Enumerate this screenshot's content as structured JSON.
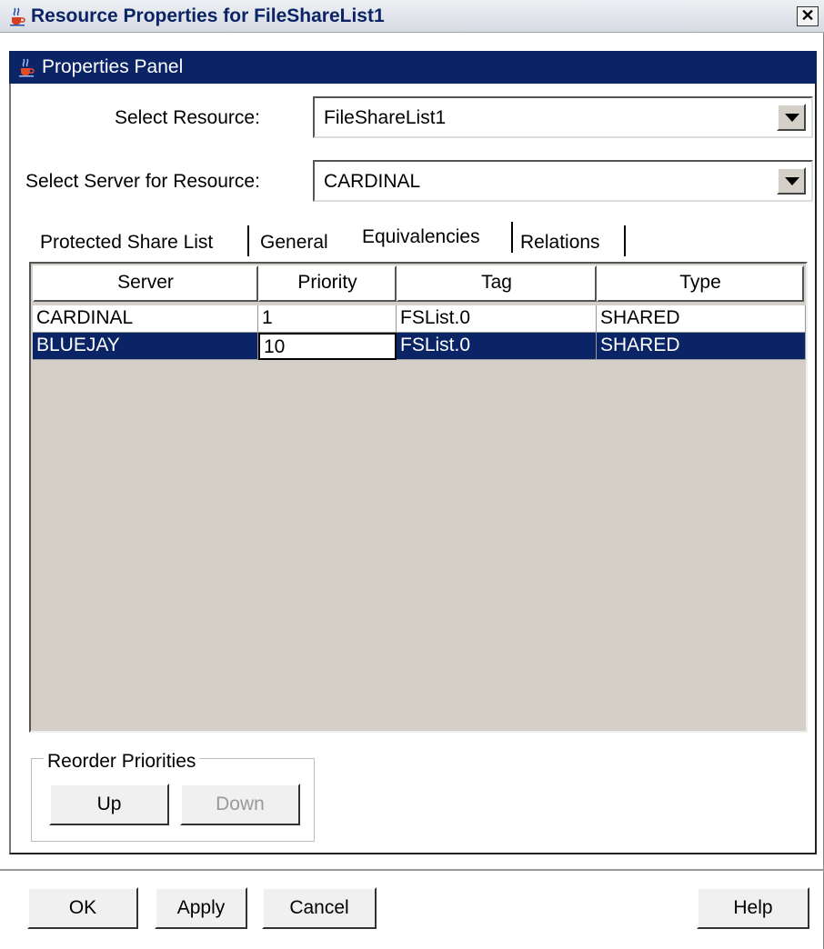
{
  "window": {
    "title": "Resource Properties for FileShareList1",
    "close_glyph": "✕"
  },
  "panel": {
    "title": "Properties Panel"
  },
  "select_resource": {
    "label": "Select Resource:",
    "value": "FileShareList1"
  },
  "select_server": {
    "label": "Select Server for Resource:",
    "value": "CARDINAL"
  },
  "tabs": [
    {
      "label": "Protected Share List"
    },
    {
      "label": "General"
    },
    {
      "label": "Equivalencies",
      "active": true
    },
    {
      "label": "Relations"
    }
  ],
  "table": {
    "columns": [
      "Server",
      "Priority",
      "Tag",
      "Type"
    ],
    "rows": [
      {
        "server": "CARDINAL",
        "priority": "1",
        "tag": "FSList.0",
        "type": "SHARED",
        "selected": false
      },
      {
        "server": "BLUEJAY",
        "priority": "10",
        "tag": "FSList.0",
        "type": "SHARED",
        "selected": true
      }
    ]
  },
  "reorder": {
    "title": "Reorder Priorities",
    "up_label": "Up",
    "down_label": "Down"
  },
  "footer": {
    "ok_label": "OK",
    "apply_label": "Apply",
    "cancel_label": "Cancel",
    "help_label": "Help"
  },
  "colors": {
    "selection": "#0a2466",
    "panel_header": "#0a2466",
    "table_background": "#d4d0c8"
  },
  "icons": {
    "window": "java-cup-icon",
    "panel": "java-cup-icon",
    "dropdown": "chevron-down-icon"
  }
}
